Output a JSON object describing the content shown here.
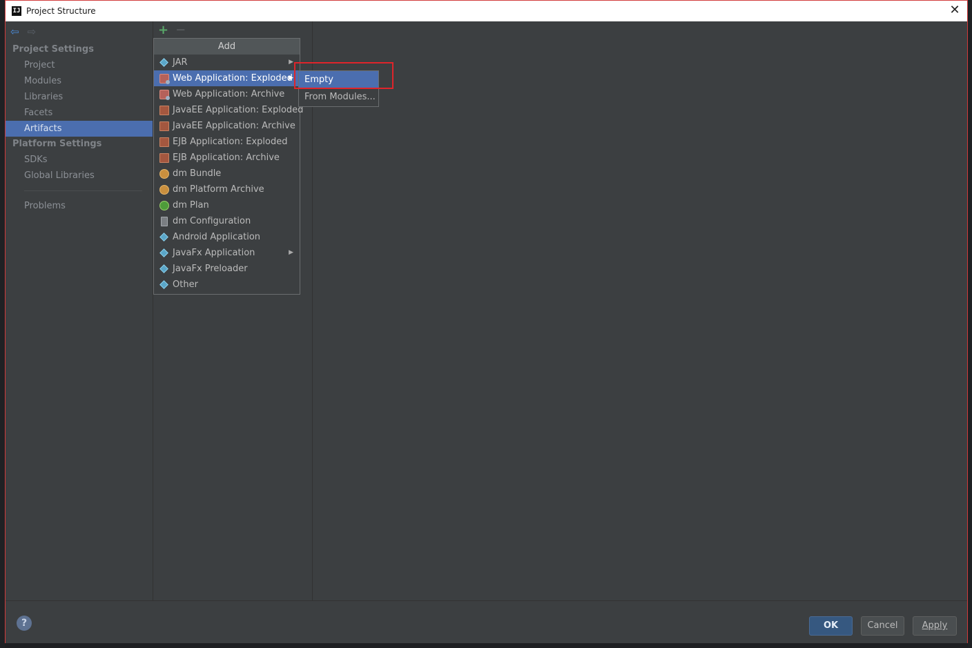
{
  "window": {
    "title": "Project Structure",
    "app_icon": "IJ"
  },
  "nav": {
    "back_icon": "⇦",
    "forward_icon": "⇨"
  },
  "sidebar": {
    "project_settings_label": "Project Settings",
    "project_items": [
      "Project",
      "Modules",
      "Libraries",
      "Facets",
      "Artifacts"
    ],
    "selected": "Artifacts",
    "platform_settings_label": "Platform Settings",
    "platform_items": [
      "SDKs",
      "Global Libraries"
    ],
    "problems_label": "Problems"
  },
  "toolbar": {
    "add_symbol": "+",
    "remove_symbol": "−"
  },
  "add_menu": {
    "title": "Add",
    "items": [
      {
        "label": "JAR",
        "icon": "diamond-icon",
        "submenu": true
      },
      {
        "label": "Web Application: Exploded",
        "icon": "web-app-icon",
        "submenu": true,
        "highlighted": true
      },
      {
        "label": "Web Application: Archive",
        "icon": "web-app-icon"
      },
      {
        "label": "JavaEE Application: Exploded",
        "icon": "javaee-icon"
      },
      {
        "label": "JavaEE Application: Archive",
        "icon": "javaee-icon"
      },
      {
        "label": "EJB Application: Exploded",
        "icon": "javaee-icon"
      },
      {
        "label": "EJB Application: Archive",
        "icon": "javaee-icon"
      },
      {
        "label": "dm Bundle",
        "icon": "dm-icon"
      },
      {
        "label": "dm Platform Archive",
        "icon": "dm-icon"
      },
      {
        "label": "dm Plan",
        "icon": "dm-plan-icon"
      },
      {
        "label": "dm Configuration",
        "icon": "document-icon"
      },
      {
        "label": "Android Application",
        "icon": "diamond-icon"
      },
      {
        "label": "JavaFx Application",
        "icon": "diamond-icon",
        "submenu": true
      },
      {
        "label": "JavaFx Preloader",
        "icon": "diamond-icon"
      },
      {
        "label": "Other",
        "icon": "diamond-icon"
      }
    ]
  },
  "submenu": {
    "items": [
      "Empty",
      "From Modules..."
    ],
    "highlighted": "Empty"
  },
  "footer": {
    "help_symbol": "?",
    "ok_label": "OK",
    "cancel_label": "Cancel",
    "apply_label": "Apply"
  },
  "colors": {
    "selection": "#4b6eaf",
    "panel_bg": "#3c3f41",
    "annotation_frame": "#e0242a"
  }
}
